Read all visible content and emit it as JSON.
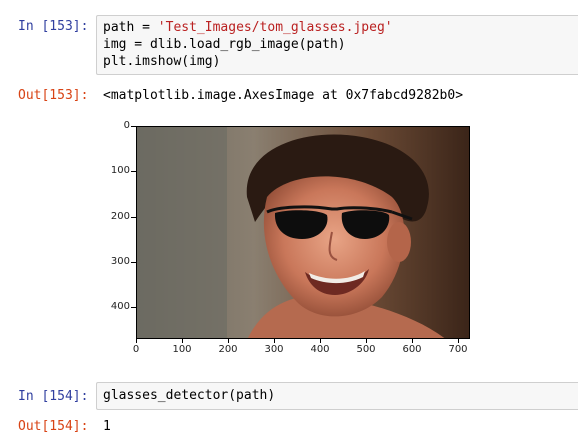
{
  "cells": [
    {
      "in_prompt": "In [153]:",
      "code_lines": [
        {
          "pre": "path = ",
          "str": "'Test_Images/tom_glasses.jpeg'",
          "post": ""
        },
        {
          "pre": "img = dlib.load_rgb_image(path)",
          "str": "",
          "post": ""
        },
        {
          "pre": "plt.imshow(img)",
          "str": "",
          "post": ""
        }
      ],
      "out_prompt": "Out[153]:",
      "output_text": "<matplotlib.image.AxesImage at 0x7fabcd9282b0>",
      "plot": {
        "yticks": [
          "0",
          "100",
          "200",
          "300",
          "400"
        ],
        "xticks": [
          "0",
          "100",
          "200",
          "300",
          "400",
          "500",
          "600",
          "700"
        ],
        "image_description_icon": "portrait-image"
      }
    },
    {
      "in_prompt": "In [154]:",
      "code_lines": [
        {
          "pre": "glasses_detector(path)",
          "str": "",
          "post": ""
        }
      ],
      "out_prompt": "Out[154]:",
      "output_text": "1"
    }
  ]
}
